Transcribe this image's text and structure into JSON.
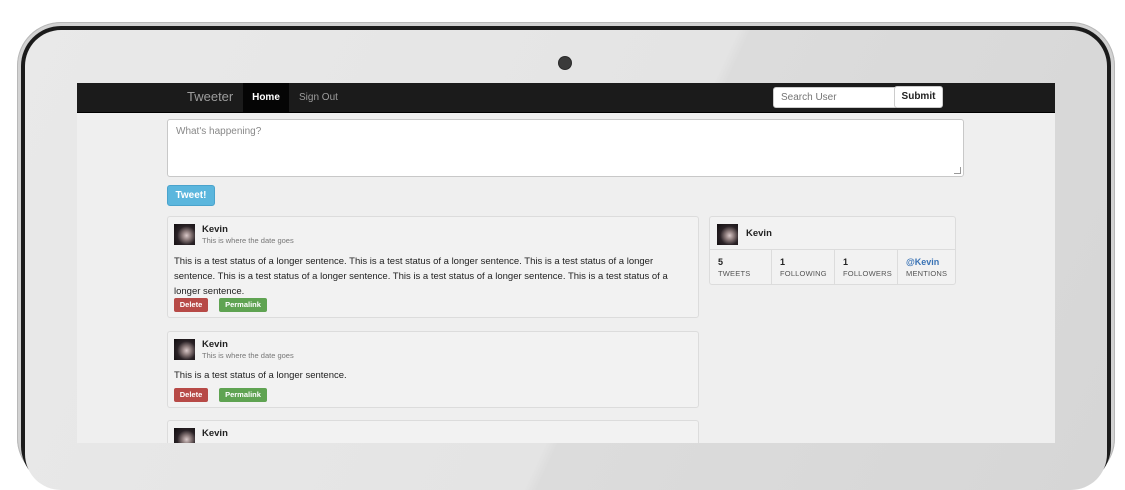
{
  "navbar": {
    "brand": "Tweeter",
    "home_label": "Home",
    "signout_label": "Sign Out",
    "search_placeholder": "Search User",
    "submit_label": "Submit"
  },
  "compose": {
    "placeholder": "What's happening?",
    "button_label": "Tweet!"
  },
  "tweets": [
    {
      "author": "Kevin",
      "date": "This is where the date goes",
      "text": "This is a test status of a longer sentence. This is a test status of a longer sentence. This is a test status of a longer sentence. This is a test status of a longer sentence. This is a test status of a longer sentence. This is a test status of a longer sentence.",
      "delete_label": "Delete",
      "permalink_label": "Permalink"
    },
    {
      "author": "Kevin",
      "date": "This is where the date goes",
      "text": "This is a test status of a longer sentence.",
      "delete_label": "Delete",
      "permalink_label": "Permalink"
    },
    {
      "author": "Kevin"
    }
  ],
  "profile": {
    "name": "Kevin",
    "stats": [
      {
        "value": "5",
        "label": "TWEETS"
      },
      {
        "value": "1",
        "label": "FOLLOWING"
      },
      {
        "value": "1",
        "label": "FOLLOWERS"
      },
      {
        "value": "@Kevin",
        "label": "MENTIONS"
      }
    ]
  },
  "colors": {
    "navbar_bg": "#1b1b1b",
    "tweet_button": "#5bb6dd",
    "delete_button": "#b74a47",
    "permalink_button": "#5fa352",
    "mention_link": "#3a73b5"
  }
}
